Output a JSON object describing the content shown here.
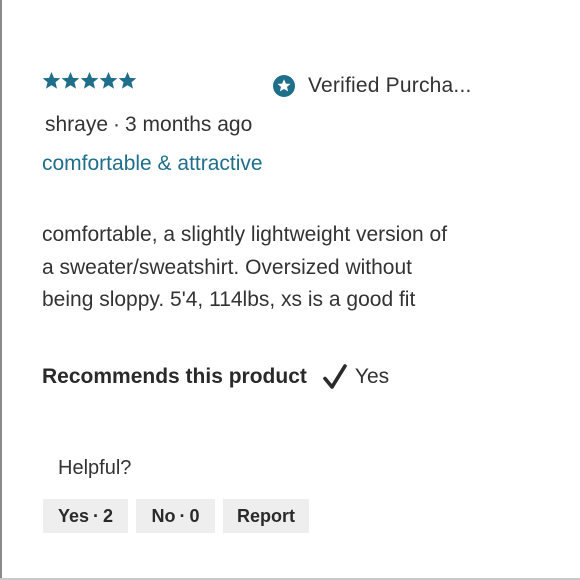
{
  "review": {
    "rating": 5,
    "rating_max": 5,
    "star_color": "#1f6f8b",
    "verified_label": "Verified Purcha...",
    "verified_icon": "star-badge-icon",
    "author": "shraye",
    "separator": "·",
    "posted": "3 months ago",
    "title": "comfortable & attractive",
    "title_color": "#1f6f8b",
    "body_lines": [
      "comfortable, a slightly lightweight version of",
      "a sweater/sweatshirt. Oversized without",
      "being sloppy. 5'4, 114lbs, xs is a good fit"
    ],
    "recommends_label": "Recommends this product",
    "recommends_icon": "check-icon",
    "recommends_value": "Yes"
  },
  "helpful": {
    "label": "Helpful?",
    "yes_label": "Yes",
    "yes_count": "2",
    "no_label": "No",
    "no_count": "0",
    "separator": "·",
    "report_label": "Report"
  }
}
